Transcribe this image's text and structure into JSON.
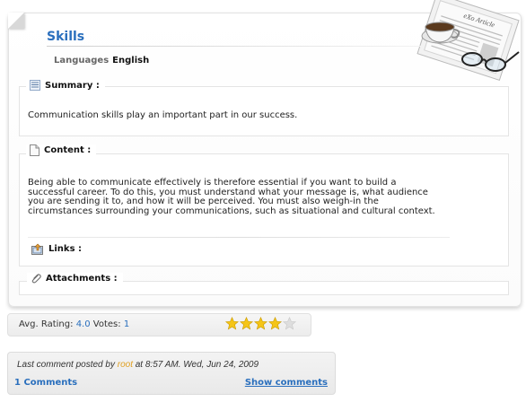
{
  "article": {
    "title": "Skills",
    "languages_label": "Languages",
    "languages_value": "English",
    "badge_text": "eXo Article"
  },
  "sections": {
    "summary": {
      "label": "Summary :",
      "text": "Communication skills play an important part in our success."
    },
    "content": {
      "label": "Content :",
      "lines": [
        "Being able to communicate effectively is therefore essential if you want to build a",
        "successful career. To do this, you must understand what your message is, what audience",
        "you are sending it to, and how it will be perceived. You must also weigh-in the",
        "circumstances surrounding your communications, such as situational and cultural context."
      ]
    },
    "links": {
      "label": "Links :"
    },
    "attachments": {
      "label": "Attachments :"
    }
  },
  "rating": {
    "avg_label": "Avg. Rating:",
    "avg_value": "4.0",
    "votes_label": "Votes:",
    "votes_value": "1",
    "stars_filled": 4,
    "stars_total": 5
  },
  "comments": {
    "last_prefix": "Last comment posted by",
    "user": "root",
    "last_suffix": "at 8:57 AM. Wed, Jun 24, 2009",
    "count_text": "1 Comments",
    "show_label": "Show comments"
  },
  "colors": {
    "accent": "#2a6fbd",
    "user": "#e0a020",
    "star_on": "#f5c518",
    "star_off": "#dedede"
  }
}
